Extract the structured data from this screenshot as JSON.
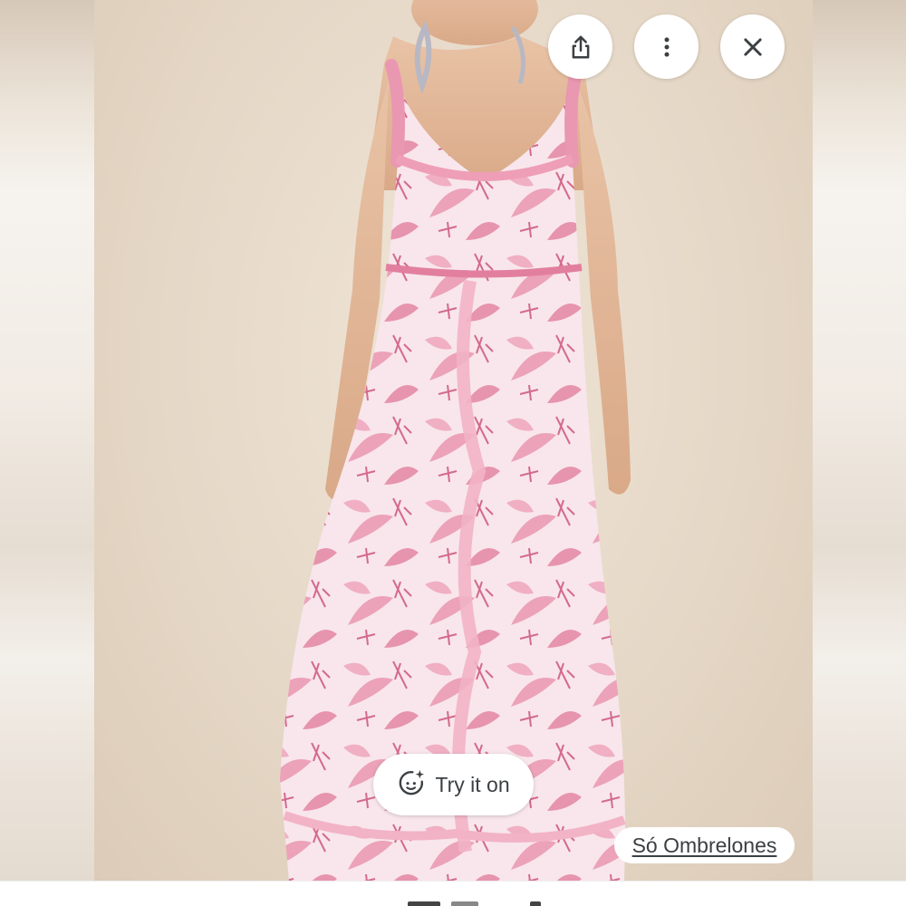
{
  "toolbar": {
    "share": {
      "icon": "share-icon"
    },
    "more": {
      "icon": "more-vertical-icon"
    },
    "close": {
      "icon": "close-icon"
    }
  },
  "image": {
    "subject": "pink floral ruffled maxi dress on model"
  },
  "try_on": {
    "label": "Try it on",
    "icon": "sparkle-face-icon"
  },
  "source": {
    "label": "Só Ombrelones"
  },
  "colors": {
    "background_wall": "#e6d8c7",
    "dress_pink": "#e58aa6",
    "button_bg": "#ffffff",
    "icon_gray": "#3c4043"
  }
}
